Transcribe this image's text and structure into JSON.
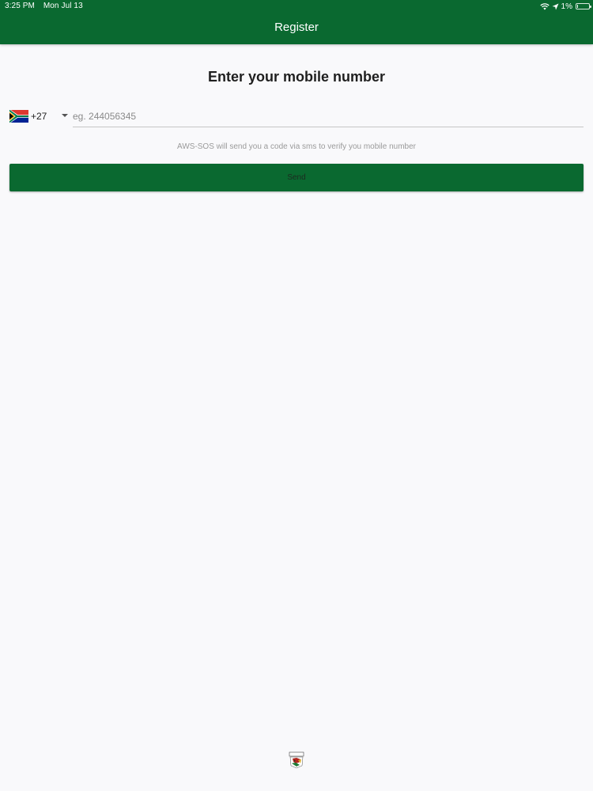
{
  "status_bar": {
    "time": "3:25 PM",
    "date": "Mon Jul 13",
    "battery": "1%",
    "icons": [
      "wifi-icon",
      "location-arrow-icon",
      "battery-icon"
    ]
  },
  "app_bar": {
    "title": "Register"
  },
  "main": {
    "heading": "Enter your mobile number",
    "country": {
      "flag": "south-africa-flag-icon",
      "dial_code": "+27"
    },
    "phone_input": {
      "value": "",
      "placeholder": "eg. 244056345"
    },
    "helper_text": "AWS-SOS will send you a code via sms to verify you mobile number",
    "send_label": "Send"
  },
  "footer": {
    "logo": "app-logo-icon"
  },
  "colors": {
    "primary": "#0a6930",
    "background": "#f9f9fb"
  }
}
